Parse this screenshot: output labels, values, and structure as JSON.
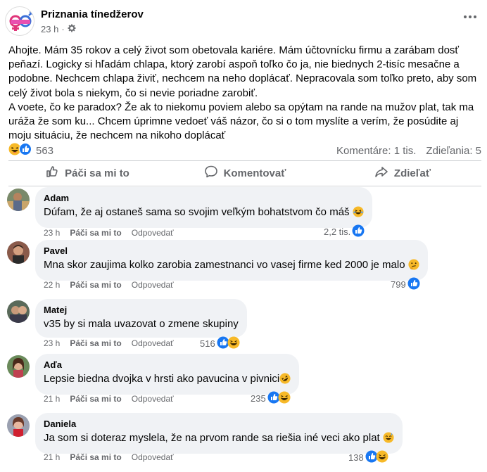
{
  "post": {
    "page_name": "Priznania tínedžerov",
    "time": "23 h",
    "separator": "·",
    "text": "Ahojte. Mám 35 rokov a celý život som obetovala kariére. Mám účtovnícku firmu a zarábam dosť peňazí. Logicky si hľadám chlapa, ktorý zarobí aspoň toľko čo ja, nie biednych 2-tisíc mesačne a podobne. Nechcem chlapa živiť, nechcem na neho doplácať. Nepracovala som toľko preto, aby som celý život bola s niekym, čo si nevie poriadne zarobiť.\nA voete, čo ke paradox? Že ak to niekomu poviem alebo sa opýtam na rande na mužov plat, tak ma uráža že som ku... Chcem úprimne vedoeť váš názor, čo si o tom myslíte a verím, že posúdite aj moju situáciu, že nechcem na nikoho doplácať",
    "reaction_count": "563",
    "comments_stat": "Komentáre: 1 tis.",
    "shares_stat": "Zdieľania: 5"
  },
  "actions": {
    "like": "Páči sa mi to",
    "comment": "Komentovať",
    "share": "Zdieľať"
  },
  "comments": [
    {
      "author": "Adam",
      "text": "Dúfam, že aj ostaneš sama so svojim veľkým bohatstvom čo máš",
      "emoji": "laugh",
      "time": "23 h",
      "like": "Páči sa mi to",
      "reply": "Odpovedať",
      "count": "2,2 tis."
    },
    {
      "author": "Pavel",
      "text": "Mna skor zaujima kolko zarobia zamestnanci vo vasej firme ked 2000 je malo",
      "emoji": "thinking",
      "time": "22 h",
      "like": "Páči sa mi to",
      "reply": "Odpovedať",
      "count": "799"
    },
    {
      "author": "Matej",
      "text": "v35 by si mala uvazovat o zmene skupiny",
      "emoji": "",
      "time": "23 h",
      "like": "Páči sa mi to",
      "reply": "Odpovedať",
      "count": "516"
    },
    {
      "author": "Aďa",
      "text": "Lepsie biedna dvojka v hrsti ako pavucina v pivnici",
      "emoji": "rofl",
      "time": "21 h",
      "like": "Páči sa mi to",
      "reply": "Odpovedať",
      "count": "235"
    },
    {
      "author": "Daniela",
      "text": "Ja som si doteraz myslela, že na prvom rande sa riešia iné veci ako plat",
      "emoji": "sweat-smile",
      "time": "21 h",
      "like": "Páči sa mi to",
      "reply": "Odpovedať",
      "count": "138"
    }
  ],
  "colors": {
    "like_blue": "#1877f2",
    "emoji_yellow": "#f7b928",
    "muted": "#65676b",
    "bubble": "#f0f2f5"
  }
}
